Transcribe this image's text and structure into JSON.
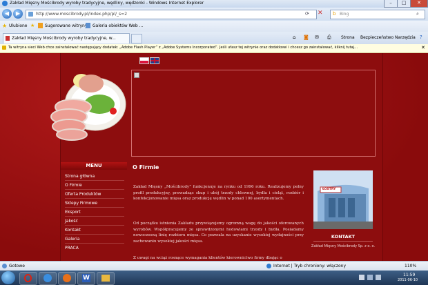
{
  "window": {
    "title": "Zakład Mięsny Mościbrody wyroby tradycyjne, wędliny, wędzonki - Windows Internet Explorer"
  },
  "address": {
    "url": "http://www.moscibrody.pl/index.php/pl/_s=2",
    "search_placeholder": "Bing"
  },
  "favorites": {
    "label": "Ulubione",
    "items": [
      "Sugerowane witryny",
      "Galeria obiektów Web ..."
    ]
  },
  "tab": {
    "label": "Zakład Mięsny Mościbrody wyroby tradycyjne, w..."
  },
  "commandbar": {
    "items": [
      "Strona",
      "Bezpieczeństwo",
      "Narzędzia"
    ]
  },
  "infobar": {
    "text": "Ta witryna sieci Web chce zainstalować następujący dodatek: „Adobe Flash Player” z „Adobe Systems Incorporated”. Jeśli ufasz tej witrynie oraz dodatkowi i chcesz go zainstalować, kliknij tutaj..."
  },
  "menu": {
    "title": "MENU",
    "items": [
      "Strona główna",
      "O Firmie",
      "Oferta Produktów",
      "Sklepy Firmowe",
      "Eksport",
      "Jakość",
      "Kontakt",
      "Galeria",
      "PRACA"
    ]
  },
  "content": {
    "heading": "O Firmie",
    "p1": "Zakład Mięsny „Mościbrody” funkcjonuje na rynku od 1996 roku. Realizujemy pełny profil produkcyjny, prowadząc skup i ubój trzody chlewnej, bydła i cieląt, rozbiór i konfekcjonowanie mięsa oraz produkcję wędlin w ponad 100 asortymentach.",
    "p2": "Od początku istnienia Zakładu przywiązujemy ogromną wagę do jakości oferowanych wyrobów. Współpracujemy ze sprawdzonymi hodowlami trzody i bydła. Posiadamy nowoczesną linię rozbioru mięsa. Co pozwala na uzyskanie wysokiej wydajności przy zachowaniu wysokiej jakości mięsa.",
    "p3": "Z uwagi na wciąż rosnące wymagania klientów kierownictwo firmy dbając o"
  },
  "contact": {
    "title": "KONTAKT",
    "name": "Zakład Mięsny Mościbrody Sp. z o. o.",
    "sign": "ŁOSTRY"
  },
  "status": {
    "left": "Gotowe",
    "zone": "Internet | Tryb chroniony: włączony",
    "zoom": "110%"
  },
  "taskbar": {
    "time": "11:59",
    "date": "2011-06-10"
  }
}
